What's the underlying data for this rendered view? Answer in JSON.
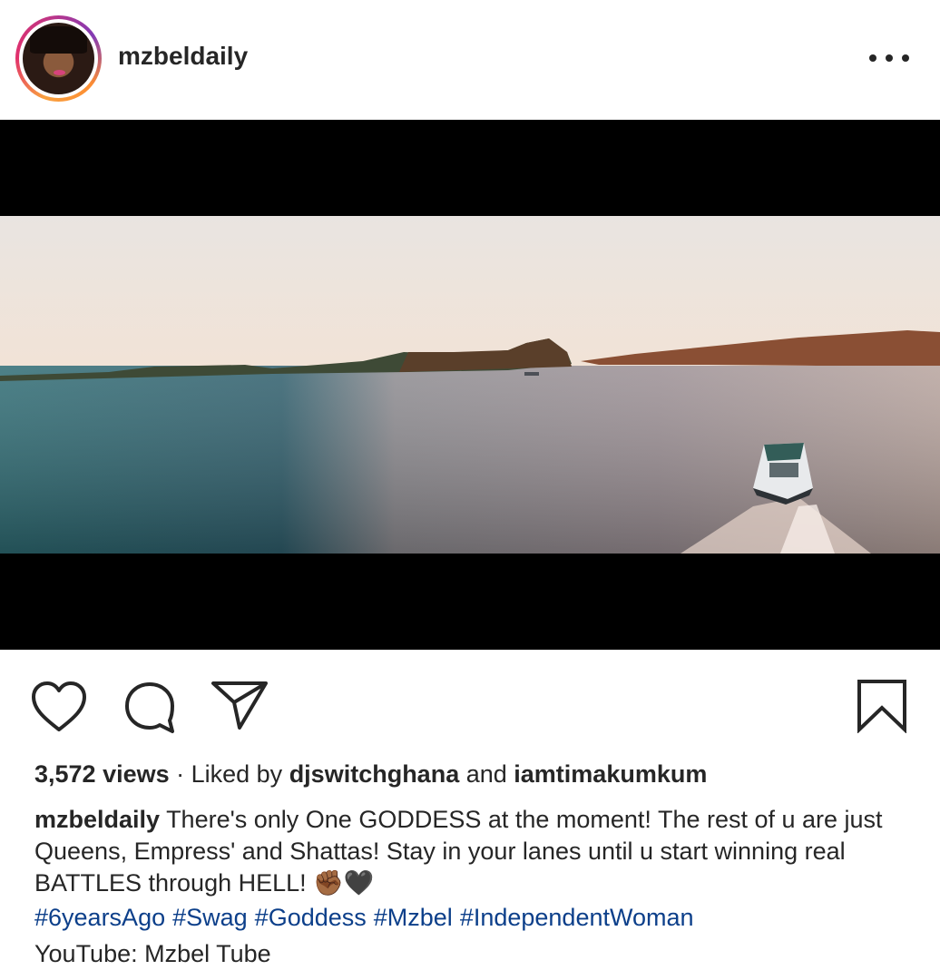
{
  "post": {
    "username": "mzbeldaily",
    "more_icon": "more-horizontal-icon"
  },
  "actions": {
    "like_icon": "heart-icon",
    "comment_icon": "comment-bubble-icon",
    "share_icon": "send-paper-plane-icon",
    "save_icon": "bookmark-icon"
  },
  "stats": {
    "views": "3,572 views",
    "separator": " · Liked by ",
    "liker1": "djswitchghana",
    "and": " and ",
    "liker2": "iamtimakumkum"
  },
  "caption": {
    "username": "mzbeldaily",
    "text": "There's only One GODDESS at the moment! The rest of u are just Queens, Empress' and Shattas! Stay in your lanes until u start winning real BATTLES through HELL! ✊🏾🖤",
    "hashtags": [
      "#6yearsAgo",
      "#Swag",
      "#Goddess",
      "#Mzbel",
      "#IndependentWoman"
    ],
    "youtube": "YouTube: Mzbel Tube"
  },
  "colors": {
    "text": "#262626",
    "hashtag": "#0c3f8a",
    "ring_start": "#f9a03f",
    "ring_end": "#c13584"
  }
}
